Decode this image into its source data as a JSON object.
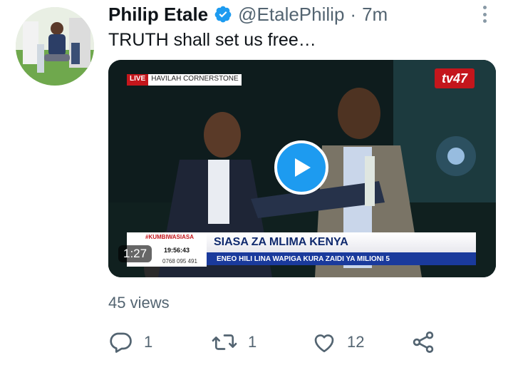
{
  "tweet": {
    "author_name": "Philip Etale",
    "handle": "@EtalePhilip",
    "separator": "·",
    "time": "7m",
    "text": "TRUTH shall set us free…",
    "views": "45 views"
  },
  "video": {
    "live_label": "LIVE",
    "location_label": "HAVILAH CORNERSTONE",
    "channel_logo": "tv47",
    "ticker_hashtag": "#KUMBIWASIASA",
    "ticker_time": "19:56:43",
    "ticker_phone": "0768 095 491",
    "ticker_headline": "SIASA ZA MLIMA KENYA",
    "ticker_subline": "ENEO HILI LINA WAPIGA KURA ZAIDI YA MILIONI 5",
    "duration": "1:27"
  },
  "actions": {
    "reply_count": "1",
    "retweet_count": "1",
    "like_count": "12"
  },
  "icons": [
    "verified-badge-icon",
    "more-options-icon",
    "play-icon",
    "reply-icon",
    "retweet-icon",
    "like-icon",
    "share-icon"
  ],
  "colors": {
    "accent": "#1d9bf0",
    "secondary_text": "#536471",
    "primary_text": "#0f1419",
    "channel_red": "#c4161c",
    "ticker_blue": "#1a3a9c"
  }
}
